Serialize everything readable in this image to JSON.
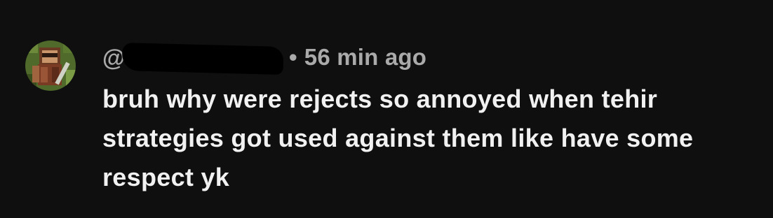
{
  "comment": {
    "handle": "@",
    "separator": "•",
    "time": "56 min ago",
    "text": "bruh why were rejects so annoyed when tehir strategies got used against them like have some respect yk"
  },
  "colors": {
    "background": "#0f0f0f",
    "meta": "#aaaaaa",
    "text": "#f1f1f1"
  },
  "icons": {
    "avatar": "minecraft-skin-avatar"
  }
}
